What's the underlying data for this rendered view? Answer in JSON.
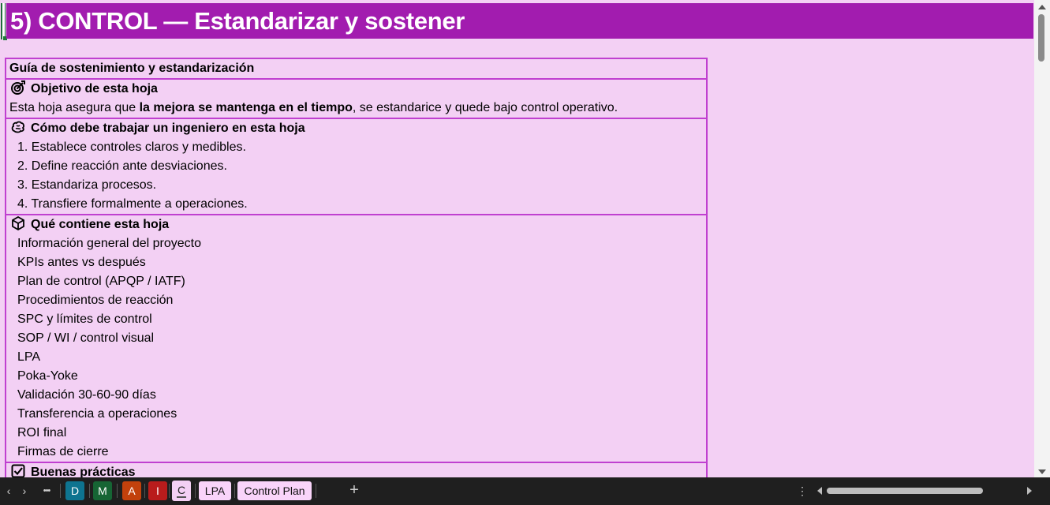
{
  "header": {
    "title": "5) CONTROL — Estandarizar y sostener"
  },
  "sheet": {
    "guide_title": "Guía de sostenimiento y estandarización",
    "objective": {
      "icon": "target-icon",
      "title": "Objetivo de esta hoja",
      "text_before": "Esta hoja asegura que ",
      "text_bold": "la mejora se mantenga en el tiempo",
      "text_after": ", se estandarice y quede bajo control operativo."
    },
    "engineer": {
      "icon": "brain-icon",
      "title": "Cómo debe trabajar un ingeniero en esta hoja",
      "steps": [
        "1. Establece controles claros y medibles.",
        "2. Define reacción ante desviaciones.",
        "3. Estandariza procesos.",
        "4. Transfiere formalmente a operaciones."
      ]
    },
    "contents": {
      "icon": "package-icon",
      "title": "Qué contiene esta hoja",
      "items": [
        "Información general del proyecto",
        "KPIs antes vs después",
        "Plan de control (APQP / IATF)",
        "Procedimientos de reacción",
        "SPC y límites de control",
        "SOP / WI / control visual",
        "LPA",
        "Poka-Yoke",
        "Validación 30-60-90 días",
        "Transferencia a operaciones",
        "ROI final",
        "Firmas de cierre"
      ]
    },
    "practices": {
      "icon": "checkbox-icon",
      "title": "Buenas prácticas"
    }
  },
  "tabbar": {
    "more_label": "•••",
    "color_tabs": [
      {
        "label": "D",
        "color": "#0e7490"
      },
      {
        "label": "M",
        "color": "#166534"
      },
      {
        "label": "A",
        "color": "#c2410c"
      },
      {
        "label": "I",
        "color": "#b91c1c"
      }
    ],
    "active_tab": "C",
    "sheet_tabs": [
      "LPA",
      "Control Plan"
    ],
    "add_label": "+"
  },
  "colors": {
    "header_bg": "#a21caf",
    "sheet_bg": "#f3d0f4",
    "border": "#c040d0",
    "tab_bg": "#f9d4fa"
  }
}
